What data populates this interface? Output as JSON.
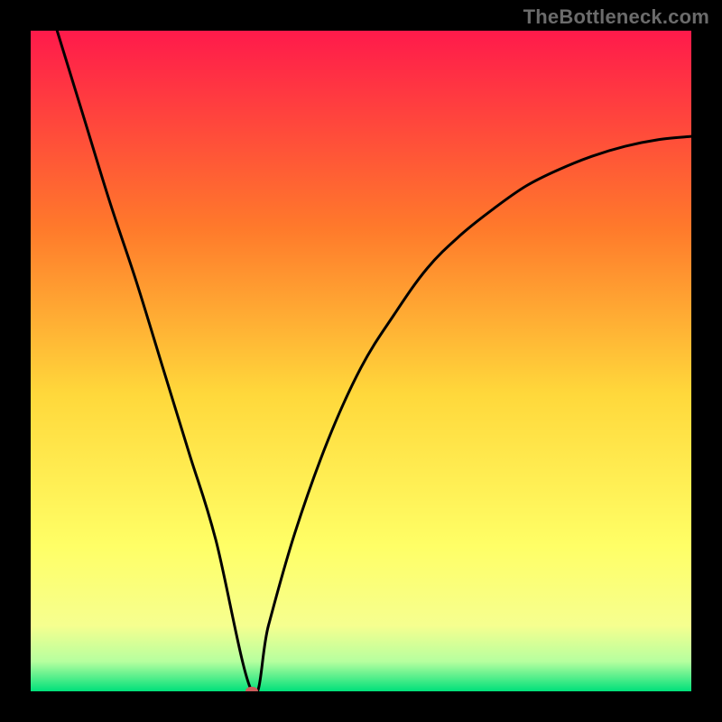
{
  "watermark": "TheBottleneck.com",
  "colors": {
    "top": "#ff1a4b",
    "mid_upper": "#ff922b",
    "mid": "#ffd83b",
    "mid_lower": "#ffff66",
    "lower_yellow": "#f6ff8f",
    "green_top": "#b6ff9f",
    "green_bottom": "#00e07a",
    "curve": "#000000",
    "marker": "#cd5c5c",
    "frame": "#000000"
  },
  "chart_data": {
    "type": "line",
    "title": "",
    "xlabel": "",
    "ylabel": "",
    "xlim": [
      0,
      100
    ],
    "ylim": [
      0,
      100
    ],
    "axes_hidden": true,
    "gradient_background": true,
    "series": [
      {
        "name": "bottleneck-curve",
        "x": [
          4,
          8,
          12,
          16,
          20,
          24,
          28,
          33.5,
          36,
          40,
          45,
          50,
          55,
          60,
          65,
          70,
          75,
          80,
          85,
          90,
          95,
          100
        ],
        "y": [
          100,
          87,
          74,
          62,
          49,
          36,
          23,
          0,
          10,
          24,
          38,
          49,
          57,
          64,
          69,
          73,
          76.5,
          79,
          81,
          82.5,
          83.5,
          84
        ]
      }
    ],
    "marker": {
      "x": 33.5,
      "y": 0
    },
    "gradient_stops": [
      {
        "pos": 0,
        "color": "#ff1a4b"
      },
      {
        "pos": 0.3,
        "color": "#ff7a2b"
      },
      {
        "pos": 0.55,
        "color": "#ffd83b"
      },
      {
        "pos": 0.78,
        "color": "#ffff66"
      },
      {
        "pos": 0.9,
        "color": "#f6ff8f"
      },
      {
        "pos": 0.955,
        "color": "#b6ff9f"
      },
      {
        "pos": 1.0,
        "color": "#00e07a"
      }
    ]
  }
}
